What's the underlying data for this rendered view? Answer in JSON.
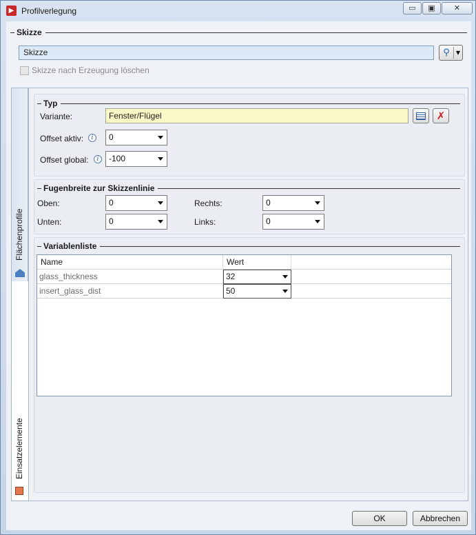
{
  "window": {
    "title": "Profilverlegung",
    "minimize": "▭",
    "maximize": "▣",
    "close": "✕"
  },
  "skizze": {
    "header": "Skizze",
    "field_value": "Skizze",
    "delete_after_create_label": "Skizze nach Erzeugung löschen",
    "delete_after_create_checked": false
  },
  "tabs": [
    {
      "label": "Flächenprofile",
      "icon": "house-icon",
      "active": false
    },
    {
      "label": "Einsatzelemente",
      "icon": "square-icon",
      "active": true
    }
  ],
  "typ": {
    "header": "Typ",
    "variante_label": "Variante:",
    "variante_value": "Fenster/Flügel",
    "offset_aktiv_label": "Offset aktiv:",
    "offset_aktiv_value": "0",
    "offset_global_label": "Offset global:",
    "offset_global_value": "-100"
  },
  "fugenbreite": {
    "header": "Fugenbreite zur Skizzenlinie",
    "oben_label": "Oben:",
    "oben_value": "0",
    "unten_label": "Unten:",
    "unten_value": "0",
    "rechts_label": "Rechts:",
    "rechts_value": "0",
    "links_label": "Links:",
    "links_value": "0"
  },
  "variablenliste": {
    "header": "Variablenliste",
    "columns": [
      "Name",
      "Wert"
    ],
    "rows": [
      {
        "name": "glass_thickness",
        "value": "32"
      },
      {
        "name": "insert_glass_dist",
        "value": "50"
      }
    ]
  },
  "footer": {
    "ok_label": "OK",
    "cancel_label": "Abbrechen"
  },
  "colors": {
    "variant_field_bg": "#fbf7c6",
    "sketch_field_bg": "#dce9f6",
    "delete_icon": "#c62020"
  }
}
